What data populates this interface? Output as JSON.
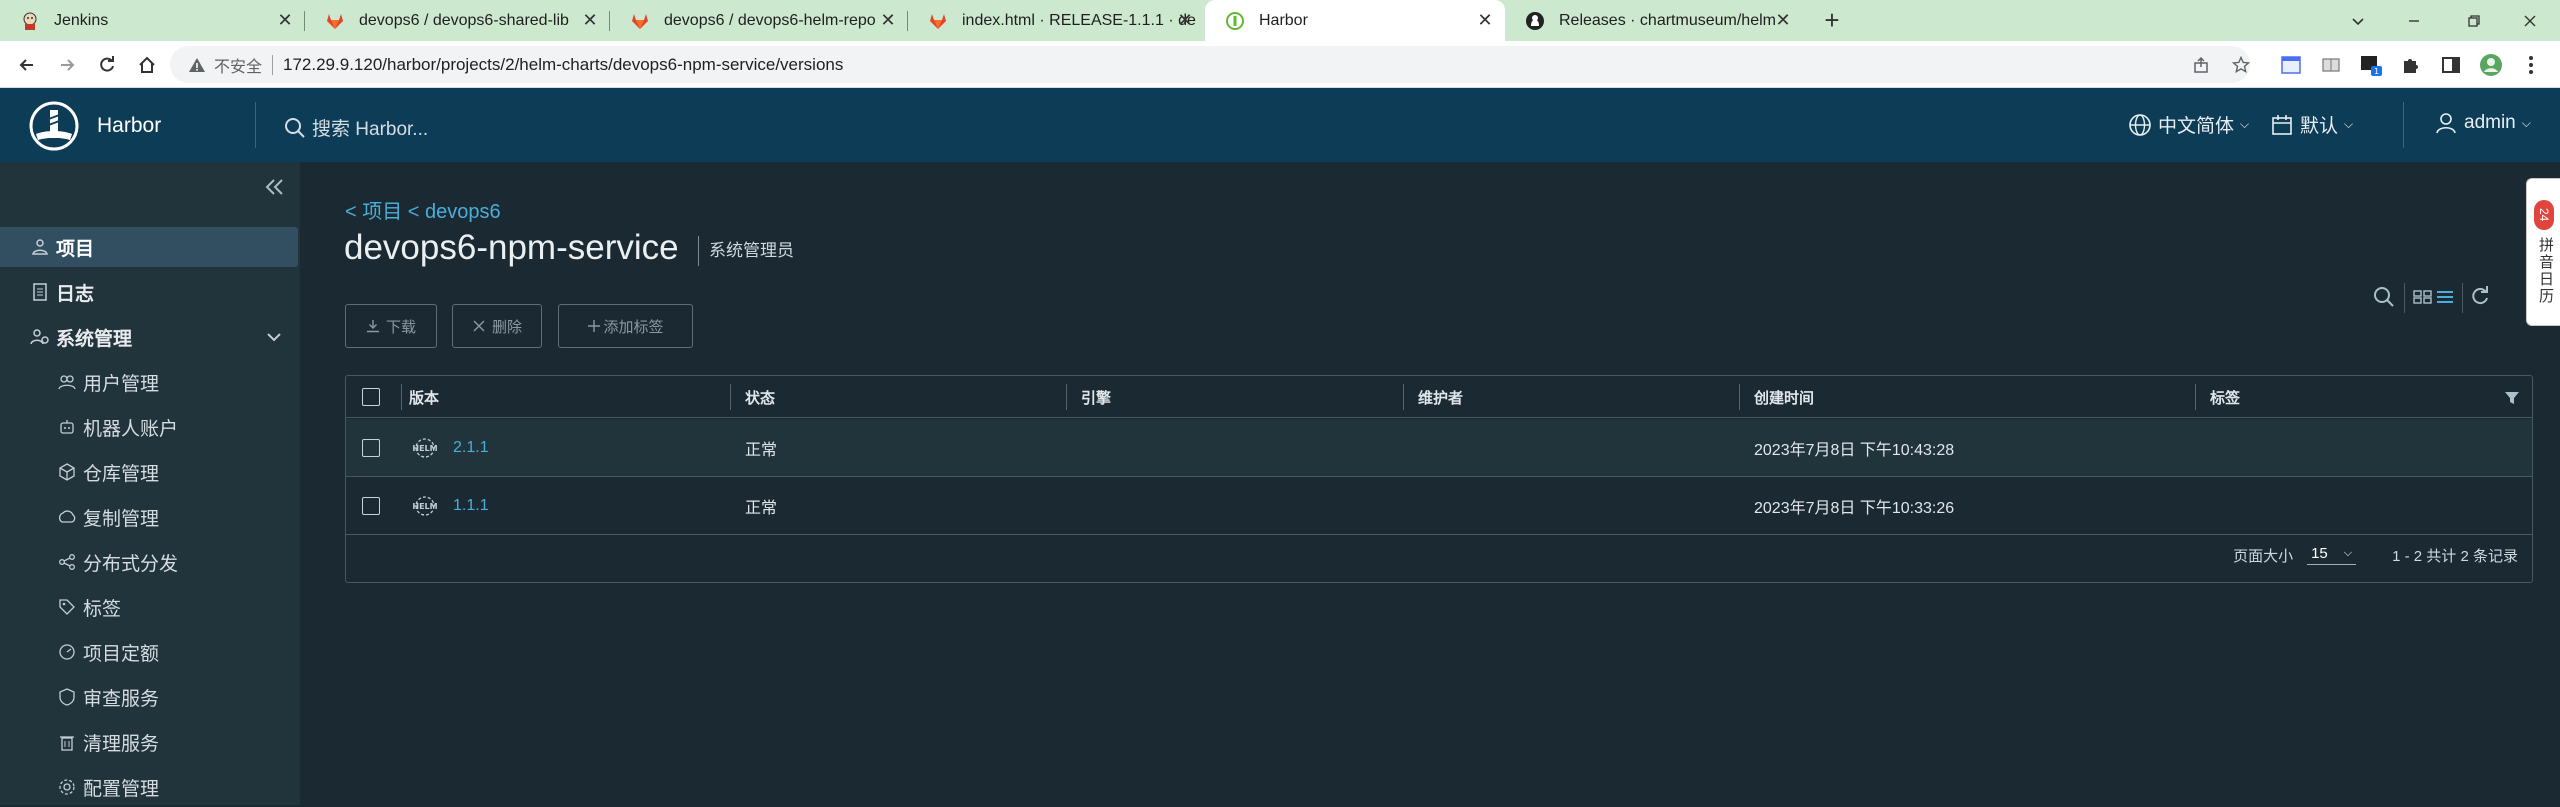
{
  "browser": {
    "tabs": [
      {
        "title": "Jenkins",
        "icon": "jenkins-icon"
      },
      {
        "title": "devops6 / devops6-shared-lib",
        "icon": "gitlab-icon"
      },
      {
        "title": "devops6 / devops6-helm-repo",
        "icon": "gitlab-icon"
      },
      {
        "title": "index.html · RELEASE-1.1.1 · de",
        "icon": "gitlab-icon"
      },
      {
        "title": "Harbor",
        "icon": "harbor-icon"
      },
      {
        "title": "Releases · chartmuseum/helm",
        "icon": "github-icon"
      }
    ],
    "new_tab": "+",
    "insecure_label": "不安全",
    "url": "172.29.9.120/harbor/projects/2/helm-charts/devops6-npm-service/versions",
    "profile_badge": "1"
  },
  "header": {
    "app_name": "Harbor",
    "search_placeholder": "搜索 Harbor...",
    "language": "中文简体",
    "date_format": "默认",
    "user": "admin"
  },
  "sidebar": {
    "items": [
      {
        "label": "项目",
        "icon": "project-icon"
      },
      {
        "label": "日志",
        "icon": "log-icon"
      },
      {
        "label": "系统管理",
        "icon": "admin-icon"
      }
    ],
    "sub_items": [
      {
        "label": "用户管理",
        "icon": "users-icon"
      },
      {
        "label": "机器人账户",
        "icon": "robot-icon"
      },
      {
        "label": "仓库管理",
        "icon": "registry-icon"
      },
      {
        "label": "复制管理",
        "icon": "replication-icon"
      },
      {
        "label": "分布式分发",
        "icon": "distribution-icon"
      },
      {
        "label": "标签",
        "icon": "tag-icon"
      },
      {
        "label": "项目定额",
        "icon": "quota-icon"
      },
      {
        "label": "审查服务",
        "icon": "scanner-icon"
      },
      {
        "label": "清理服务",
        "icon": "cleanup-icon"
      },
      {
        "label": "配置管理",
        "icon": "config-icon"
      }
    ]
  },
  "main": {
    "breadcrumb": "< 项目 < devops6",
    "title": "devops6-npm-service",
    "role": "系统管理员",
    "actions": {
      "download": "下载",
      "delete": "删除",
      "add_label": "添加标签"
    },
    "columns": [
      "版本",
      "状态",
      "引擎",
      "维护者",
      "创建时间",
      "标签"
    ],
    "rows": [
      {
        "version": "2.1.1",
        "status": "正常",
        "engine": "",
        "maintainer": "",
        "created": "2023年7月8日 下午10:43:28",
        "labels": ""
      },
      {
        "version": "1.1.1",
        "status": "正常",
        "engine": "",
        "maintainer": "",
        "created": "2023年7月8日 下午10:33:26",
        "labels": ""
      }
    ],
    "footer": {
      "page_size_label": "页面大小",
      "page_size": "15",
      "summary": "1 - 2 共计 2 条记录"
    }
  },
  "side_widget": {
    "badge": "24",
    "label": "拼音日历"
  }
}
